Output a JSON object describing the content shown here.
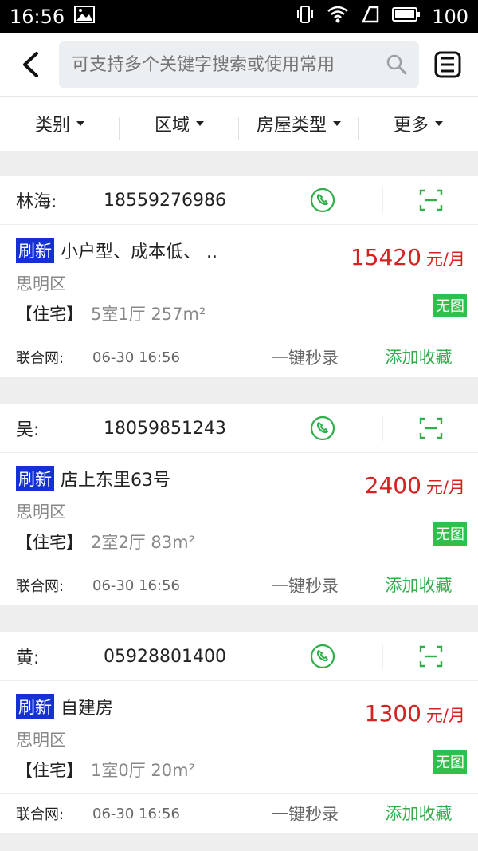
{
  "status_bar": {
    "time": "16:56",
    "battery": "100"
  },
  "search": {
    "placeholder": "可支持多个关键字搜索或使用常用"
  },
  "filters": [
    {
      "label": "类别"
    },
    {
      "label": "区域"
    },
    {
      "label": "房屋类型"
    },
    {
      "label": "更多"
    }
  ],
  "listings": [
    {
      "contact_name": "林海:",
      "phone": "18559276986",
      "tag": "刷新",
      "title": "小户型、成本低、 ..",
      "price": "15420",
      "price_unit": "元/月",
      "district": "思明区",
      "type": "【住宅】",
      "spec": "5室1厅  257m²",
      "no_image": "无图",
      "source": "联合网:",
      "time": "06-30 16:56",
      "record_label": "一键秒录",
      "fav_label": "添加收藏"
    },
    {
      "contact_name": "吴:",
      "phone": "18059851243",
      "tag": "刷新",
      "title": "店上东里63号",
      "price": "2400",
      "price_unit": "元/月",
      "district": "思明区",
      "type": "【住宅】",
      "spec": "2室2厅  83m²",
      "no_image": "无图",
      "source": "联合网:",
      "time": "06-30 16:56",
      "record_label": "一键秒录",
      "fav_label": "添加收藏"
    },
    {
      "contact_name": "黄:",
      "phone": "05928801400",
      "tag": "刷新",
      "title": "自建房",
      "price": "1300",
      "price_unit": "元/月",
      "district": "思明区",
      "type": "【住宅】",
      "spec": "1室0厅  20m²",
      "no_image": "无图",
      "source": "联合网:",
      "time": "06-30 16:56",
      "record_label": "一键秒录",
      "fav_label": "添加收藏"
    }
  ],
  "icons": {
    "back": "back-arrow-icon",
    "search": "search-icon",
    "save": "save-icon",
    "call": "phone-icon",
    "scan": "scan-icon"
  },
  "colors": {
    "price": "#d32222",
    "accent": "#2fae4a",
    "tag": "#1531d6"
  }
}
